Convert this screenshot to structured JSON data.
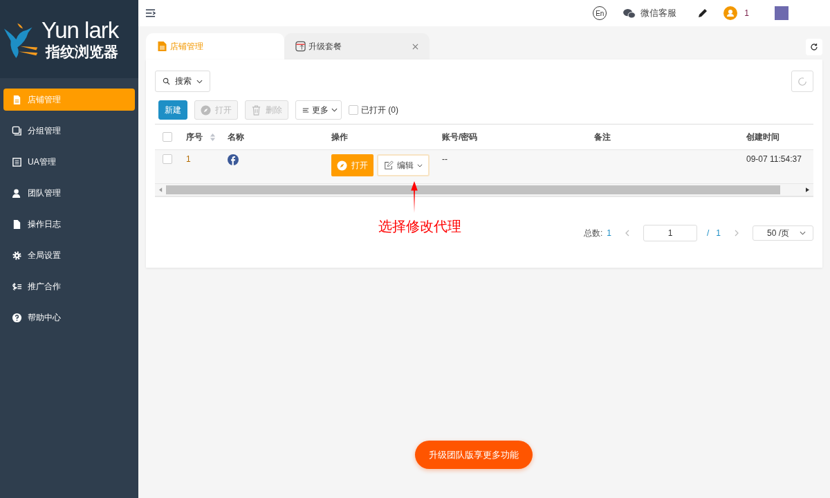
{
  "logo": {
    "brand": "Yun lark",
    "subtitle": "指纹浏览器"
  },
  "sidebar": {
    "items": [
      {
        "label": "店铺管理",
        "selected": true
      },
      {
        "label": "分组管理",
        "selected": false
      },
      {
        "label": "UA管理",
        "selected": false
      },
      {
        "label": "团队管理",
        "selected": false
      },
      {
        "label": "操作日志",
        "selected": false
      },
      {
        "label": "全局设置",
        "selected": false
      },
      {
        "label": "推广合作",
        "selected": false
      },
      {
        "label": "帮助中心",
        "selected": false
      }
    ]
  },
  "header": {
    "language": "En",
    "support": "微信客服",
    "user_count": "1"
  },
  "tabs": [
    {
      "label": "店铺管理",
      "selected": true,
      "closable": false
    },
    {
      "label": "升级套餐",
      "selected": false,
      "closable": true
    }
  ],
  "search": {
    "label": "搜索"
  },
  "toolbar": {
    "buttons": [
      {
        "label": "新建",
        "kind": "primary",
        "disabled": false
      },
      {
        "label": "打开",
        "kind": "open",
        "disabled": true
      },
      {
        "label": "删除",
        "kind": "delete",
        "disabled": true
      },
      {
        "label": "更多",
        "kind": "more",
        "disabled": false
      }
    ],
    "opened_filter": {
      "label": "已打开 (0)",
      "checked": false
    }
  },
  "table": {
    "all_checked": false,
    "columns": [
      "序号",
      "名称",
      "操作",
      "账号/密码",
      "备注",
      "创建时间"
    ],
    "rows": [
      {
        "checked": false,
        "index": "1",
        "open_label": "打开",
        "edit_label": "编辑",
        "account": "--",
        "created": "09-07 11:54:37"
      }
    ]
  },
  "annotation": "选择修改代理",
  "pagination": {
    "total_label": "总数:",
    "total": "1",
    "page": "1",
    "separator": "/",
    "pages": "1",
    "page_size": "50 /页"
  },
  "upgrade_button": "升级团队版享更多功能"
}
